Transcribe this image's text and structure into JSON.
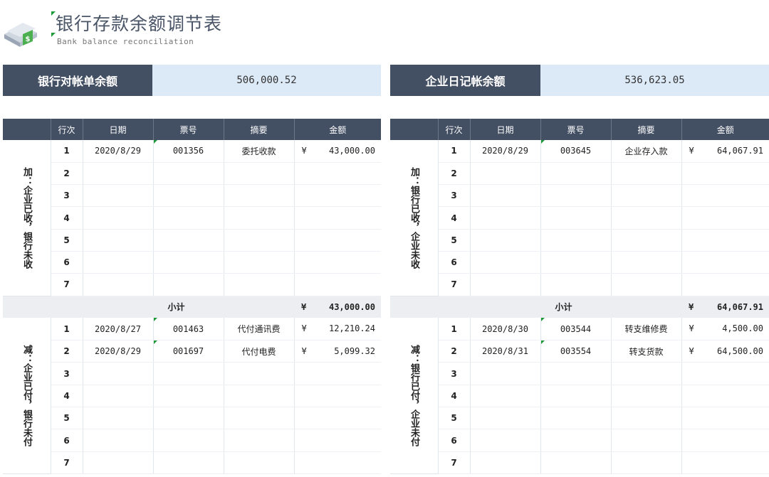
{
  "header": {
    "title": "银行存款余额调节表",
    "subtitle": "Bank balance reconciliation",
    "logo_icon": "document-stack-icon"
  },
  "balances": {
    "bank_label": "银行对帐单余额",
    "bank_value": "506,000.52",
    "company_label": "企业日记帐余额",
    "company_value": "536,623.05"
  },
  "colors": {
    "header_dark": "#434f63",
    "value_light": "#dce9f7",
    "subtotal_bg": "#eceef1",
    "mark_green": "#1f9a3a"
  },
  "columns": [
    "行次",
    "日期",
    "票号",
    "摘要",
    "金额"
  ],
  "currency": "¥",
  "left": {
    "add_label": "加：企业已收，银行未收",
    "add_rows": [
      {
        "n": "1",
        "date": "2020/8/29",
        "ticket": "001356",
        "memo": "委托收款",
        "amount": "43,000.00"
      },
      {
        "n": "2",
        "date": "",
        "ticket": "",
        "memo": "",
        "amount": ""
      },
      {
        "n": "3",
        "date": "",
        "ticket": "",
        "memo": "",
        "amount": ""
      },
      {
        "n": "4",
        "date": "",
        "ticket": "",
        "memo": "",
        "amount": ""
      },
      {
        "n": "5",
        "date": "",
        "ticket": "",
        "memo": "",
        "amount": ""
      },
      {
        "n": "6",
        "date": "",
        "ticket": "",
        "memo": "",
        "amount": ""
      },
      {
        "n": "7",
        "date": "",
        "ticket": "",
        "memo": "",
        "amount": ""
      }
    ],
    "subtotal_label": "小计",
    "subtotal": "43,000.00",
    "sub_label": "减：企业已付，银行未付",
    "sub_rows": [
      {
        "n": "1",
        "date": "2020/8/27",
        "ticket": "001463",
        "memo": "代付通讯费",
        "amount": "12,210.24"
      },
      {
        "n": "2",
        "date": "2020/8/29",
        "ticket": "001697",
        "memo": "代付电费",
        "amount": "5,099.32"
      },
      {
        "n": "3",
        "date": "",
        "ticket": "",
        "memo": "",
        "amount": ""
      },
      {
        "n": "4",
        "date": "",
        "ticket": "",
        "memo": "",
        "amount": ""
      },
      {
        "n": "5",
        "date": "",
        "ticket": "",
        "memo": "",
        "amount": ""
      },
      {
        "n": "6",
        "date": "",
        "ticket": "",
        "memo": "",
        "amount": ""
      },
      {
        "n": "7",
        "date": "",
        "ticket": "",
        "memo": "",
        "amount": ""
      }
    ]
  },
  "right": {
    "add_label": "加：银行已收，企业未收",
    "add_rows": [
      {
        "n": "1",
        "date": "2020/8/29",
        "ticket": "003645",
        "memo": "企业存入款",
        "amount": "64,067.91"
      },
      {
        "n": "2",
        "date": "",
        "ticket": "",
        "memo": "",
        "amount": ""
      },
      {
        "n": "3",
        "date": "",
        "ticket": "",
        "memo": "",
        "amount": ""
      },
      {
        "n": "4",
        "date": "",
        "ticket": "",
        "memo": "",
        "amount": ""
      },
      {
        "n": "5",
        "date": "",
        "ticket": "",
        "memo": "",
        "amount": ""
      },
      {
        "n": "6",
        "date": "",
        "ticket": "",
        "memo": "",
        "amount": ""
      },
      {
        "n": "7",
        "date": "",
        "ticket": "",
        "memo": "",
        "amount": ""
      }
    ],
    "subtotal_label": "小计",
    "subtotal": "64,067.91",
    "sub_label": "减：银行已付，企业未付",
    "sub_rows": [
      {
        "n": "1",
        "date": "2020/8/30",
        "ticket": "003544",
        "memo": "转支维修费",
        "amount": "4,500.00"
      },
      {
        "n": "2",
        "date": "2020/8/31",
        "ticket": "003554",
        "memo": "转支货款",
        "amount": "64,500.00"
      },
      {
        "n": "3",
        "date": "",
        "ticket": "",
        "memo": "",
        "amount": ""
      },
      {
        "n": "4",
        "date": "",
        "ticket": "",
        "memo": "",
        "amount": ""
      },
      {
        "n": "5",
        "date": "",
        "ticket": "",
        "memo": "",
        "amount": ""
      },
      {
        "n": "6",
        "date": "",
        "ticket": "",
        "memo": "",
        "amount": ""
      },
      {
        "n": "7",
        "date": "",
        "ticket": "",
        "memo": "",
        "amount": ""
      }
    ]
  }
}
